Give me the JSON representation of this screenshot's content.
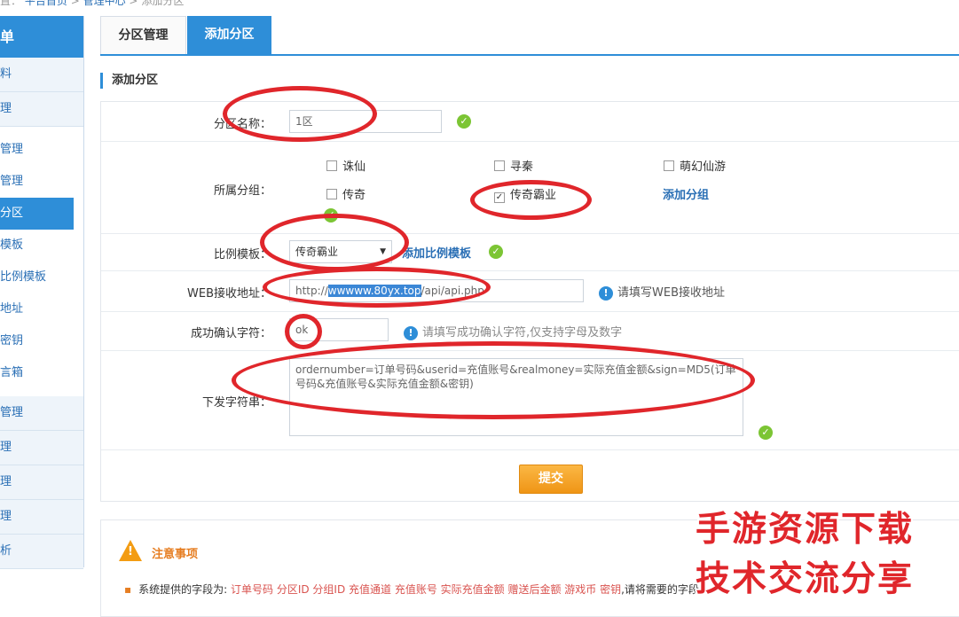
{
  "breadcrumb": {
    "prefix": "置：",
    "home": "平台首页",
    "sep1": ">",
    "manage": "管理中心",
    "sep2": ">",
    "current": "添加分区"
  },
  "sidebar": {
    "head": "单",
    "items": [
      {
        "label": "料"
      },
      {
        "label": "理"
      }
    ],
    "subs": [
      {
        "label": "管理"
      },
      {
        "label": "管理"
      },
      {
        "label": "分区"
      },
      {
        "label": "模板"
      },
      {
        "label": "比例模板"
      },
      {
        "label": "地址"
      },
      {
        "label": "密钥"
      },
      {
        "label": "言箱"
      }
    ],
    "more": [
      {
        "label": "管理"
      },
      {
        "label": "理"
      },
      {
        "label": "理"
      },
      {
        "label": "理"
      },
      {
        "label": "析"
      }
    ]
  },
  "tabs": [
    {
      "label": "分区管理"
    },
    {
      "label": "添加分区"
    }
  ],
  "section_title": "添加分区",
  "form": {
    "name_label": "分区名称：",
    "name_value": "1区",
    "group_label": "所属分组：",
    "groups": [
      {
        "label": "诛仙",
        "checked": false
      },
      {
        "label": "寻秦",
        "checked": false
      },
      {
        "label": "萌幻仙游",
        "checked": false
      },
      {
        "label": "传奇",
        "checked": false
      },
      {
        "label": "传奇霸业",
        "checked": true
      }
    ],
    "add_group": "添加分组",
    "ratio_label": "比例模板：",
    "ratio_value": "传奇霸业",
    "add_ratio": "添加比例模板",
    "web_label": "WEB接收地址：",
    "web_prefix": "http://",
    "web_selected": "wwwww.80yx.top",
    "web_suffix": "/api/api.php",
    "web_hint": "请填写WEB接收地址",
    "confirm_label": "成功确认字符：",
    "confirm_value": "ok",
    "confirm_hint": "请填写成功确认字符,仅支持字母及数字",
    "issue_label": "下发字符串：",
    "issue_value": "ordernumber=订单号码&userid=充值账号&realmoney=实际充值金额&sign=MD5(订单号码&充值账号&实际充值金额&密钥)",
    "submit": "提交"
  },
  "notice": {
    "title": "注意事项",
    "intro": "系统提供的字段为:",
    "fields": "订单号码 分区ID 分组ID 充值通道 充值账号 实际充值金额 赠送后金额 游戏币 密钥",
    "outro": ",请将需要的字段"
  },
  "watermark": {
    "line1": "手游资源下载",
    "line2": "技术交流分享"
  },
  "colors": {
    "accent": "#2e8ed8",
    "annotation": "#e0262b",
    "submit": "#f5a623",
    "ok": "#7cc534"
  }
}
